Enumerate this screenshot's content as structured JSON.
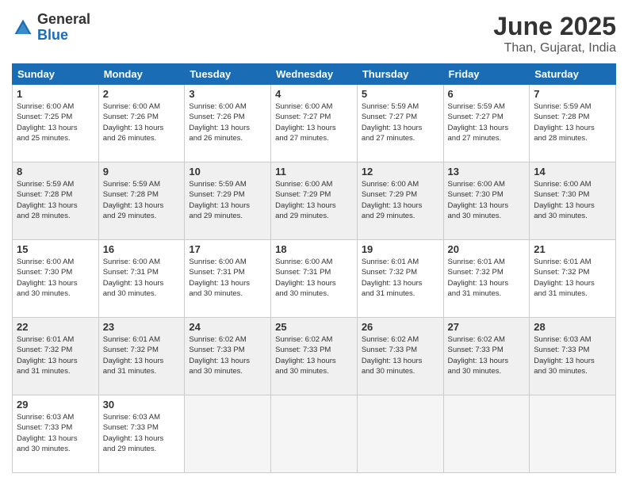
{
  "logo": {
    "general": "General",
    "blue": "Blue"
  },
  "title": "June 2025",
  "location": "Than, Gujarat, India",
  "weekdays": [
    "Sunday",
    "Monday",
    "Tuesday",
    "Wednesday",
    "Thursday",
    "Friday",
    "Saturday"
  ],
  "weeks": [
    [
      {
        "day": "1",
        "sunrise": "6:00 AM",
        "sunset": "7:25 PM",
        "daylight": "13 hours and 25 minutes."
      },
      {
        "day": "2",
        "sunrise": "6:00 AM",
        "sunset": "7:26 PM",
        "daylight": "13 hours and 26 minutes."
      },
      {
        "day": "3",
        "sunrise": "6:00 AM",
        "sunset": "7:26 PM",
        "daylight": "13 hours and 26 minutes."
      },
      {
        "day": "4",
        "sunrise": "6:00 AM",
        "sunset": "7:27 PM",
        "daylight": "13 hours and 27 minutes."
      },
      {
        "day": "5",
        "sunrise": "5:59 AM",
        "sunset": "7:27 PM",
        "daylight": "13 hours and 27 minutes."
      },
      {
        "day": "6",
        "sunrise": "5:59 AM",
        "sunset": "7:27 PM",
        "daylight": "13 hours and 27 minutes."
      },
      {
        "day": "7",
        "sunrise": "5:59 AM",
        "sunset": "7:28 PM",
        "daylight": "13 hours and 28 minutes."
      }
    ],
    [
      {
        "day": "8",
        "sunrise": "5:59 AM",
        "sunset": "7:28 PM",
        "daylight": "13 hours and 28 minutes."
      },
      {
        "day": "9",
        "sunrise": "5:59 AM",
        "sunset": "7:28 PM",
        "daylight": "13 hours and 29 minutes."
      },
      {
        "day": "10",
        "sunrise": "5:59 AM",
        "sunset": "7:29 PM",
        "daylight": "13 hours and 29 minutes."
      },
      {
        "day": "11",
        "sunrise": "6:00 AM",
        "sunset": "7:29 PM",
        "daylight": "13 hours and 29 minutes."
      },
      {
        "day": "12",
        "sunrise": "6:00 AM",
        "sunset": "7:29 PM",
        "daylight": "13 hours and 29 minutes."
      },
      {
        "day": "13",
        "sunrise": "6:00 AM",
        "sunset": "7:30 PM",
        "daylight": "13 hours and 30 minutes."
      },
      {
        "day": "14",
        "sunrise": "6:00 AM",
        "sunset": "7:30 PM",
        "daylight": "13 hours and 30 minutes."
      }
    ],
    [
      {
        "day": "15",
        "sunrise": "6:00 AM",
        "sunset": "7:30 PM",
        "daylight": "13 hours and 30 minutes."
      },
      {
        "day": "16",
        "sunrise": "6:00 AM",
        "sunset": "7:31 PM",
        "daylight": "13 hours and 30 minutes."
      },
      {
        "day": "17",
        "sunrise": "6:00 AM",
        "sunset": "7:31 PM",
        "daylight": "13 hours and 30 minutes."
      },
      {
        "day": "18",
        "sunrise": "6:00 AM",
        "sunset": "7:31 PM",
        "daylight": "13 hours and 30 minutes."
      },
      {
        "day": "19",
        "sunrise": "6:01 AM",
        "sunset": "7:32 PM",
        "daylight": "13 hours and 31 minutes."
      },
      {
        "day": "20",
        "sunrise": "6:01 AM",
        "sunset": "7:32 PM",
        "daylight": "13 hours and 31 minutes."
      },
      {
        "day": "21",
        "sunrise": "6:01 AM",
        "sunset": "7:32 PM",
        "daylight": "13 hours and 31 minutes."
      }
    ],
    [
      {
        "day": "22",
        "sunrise": "6:01 AM",
        "sunset": "7:32 PM",
        "daylight": "13 hours and 31 minutes."
      },
      {
        "day": "23",
        "sunrise": "6:01 AM",
        "sunset": "7:32 PM",
        "daylight": "13 hours and 31 minutes."
      },
      {
        "day": "24",
        "sunrise": "6:02 AM",
        "sunset": "7:33 PM",
        "daylight": "13 hours and 30 minutes."
      },
      {
        "day": "25",
        "sunrise": "6:02 AM",
        "sunset": "7:33 PM",
        "daylight": "13 hours and 30 minutes."
      },
      {
        "day": "26",
        "sunrise": "6:02 AM",
        "sunset": "7:33 PM",
        "daylight": "13 hours and 30 minutes."
      },
      {
        "day": "27",
        "sunrise": "6:02 AM",
        "sunset": "7:33 PM",
        "daylight": "13 hours and 30 minutes."
      },
      {
        "day": "28",
        "sunrise": "6:03 AM",
        "sunset": "7:33 PM",
        "daylight": "13 hours and 30 minutes."
      }
    ],
    [
      {
        "day": "29",
        "sunrise": "6:03 AM",
        "sunset": "7:33 PM",
        "daylight": "13 hours and 30 minutes."
      },
      {
        "day": "30",
        "sunrise": "6:03 AM",
        "sunset": "7:33 PM",
        "daylight": "13 hours and 29 minutes."
      },
      null,
      null,
      null,
      null,
      null
    ]
  ]
}
